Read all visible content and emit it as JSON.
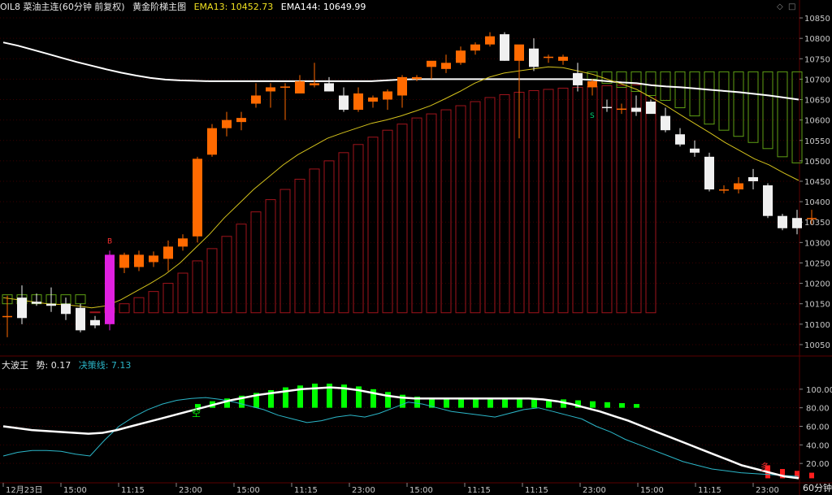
{
  "header": {
    "title": "OIL8 菜油主连(60分钟 前复权)",
    "template": "黄金阶梯主图",
    "ema13_label": "EMA13: 10452.73",
    "ema144_label": "EMA144: 10649.99",
    "diamond_icon": "diamond-icon",
    "square_icon": "square-icon"
  },
  "sub_header": {
    "indicator": "大波王",
    "trend_label": "势: 0.17",
    "decision_label": "决策线: 7.13"
  },
  "period_label": "60分钟",
  "colors": {
    "background": "#000000",
    "bull": "#ff6a00",
    "bear": "#f0f0f0",
    "ema13": "#d4c21c",
    "ema144": "#ffffff",
    "ladder_red": "#a0141c",
    "ladder_green": "#5fa014",
    "osc_white": "#ffffff",
    "osc_cyan": "#2bb6c8",
    "osc_green": "#00ff00",
    "osc_red": "#ff1e1e",
    "axis_text": "#c8c8c8",
    "grid": "#3a0000"
  },
  "chart_data": [
    {
      "type": "candlestick",
      "title": "OIL8 菜油主连(60分钟 前复权)",
      "y_ticks": [
        10850,
        10800,
        10750,
        10700,
        10650,
        10600,
        10550,
        10500,
        10450,
        10400,
        10350,
        10300,
        10250,
        10200,
        10150,
        10100,
        10050
      ],
      "ylim": [
        10026,
        10866
      ],
      "candles": [
        {
          "o": 10120,
          "h": 10170,
          "l": 10068,
          "c": 10120
        },
        {
          "o": 10165,
          "h": 10195,
          "l": 10100,
          "c": 10115
        },
        {
          "o": 10155,
          "h": 10175,
          "l": 10145,
          "c": 10150
        },
        {
          "o": 10150,
          "h": 10190,
          "l": 10130,
          "c": 10145
        },
        {
          "o": 10150,
          "h": 10165,
          "l": 10110,
          "c": 10125
        },
        {
          "o": 10140,
          "h": 10150,
          "l": 10080,
          "c": 10085
        },
        {
          "o": 10110,
          "h": 10120,
          "l": 10090,
          "c": 10097
        },
        {
          "o": 10100,
          "h": 10280,
          "l": 10085,
          "c": 10270
        },
        {
          "o": 10238,
          "h": 10275,
          "l": 10225,
          "c": 10270
        },
        {
          "o": 10240,
          "h": 10280,
          "l": 10230,
          "c": 10270
        },
        {
          "o": 10252,
          "h": 10278,
          "l": 10240,
          "c": 10268
        },
        {
          "o": 10260,
          "h": 10305,
          "l": 10230,
          "c": 10290
        },
        {
          "o": 10290,
          "h": 10320,
          "l": 10280,
          "c": 10310
        },
        {
          "o": 10315,
          "h": 10510,
          "l": 10300,
          "c": 10505
        },
        {
          "o": 10515,
          "h": 10590,
          "l": 10510,
          "c": 10580
        },
        {
          "o": 10580,
          "h": 10620,
          "l": 10560,
          "c": 10600
        },
        {
          "o": 10595,
          "h": 10620,
          "l": 10575,
          "c": 10605
        },
        {
          "o": 10640,
          "h": 10690,
          "l": 10630,
          "c": 10660
        },
        {
          "o": 10670,
          "h": 10690,
          "l": 10630,
          "c": 10680
        },
        {
          "o": 10680,
          "h": 10690,
          "l": 10600,
          "c": 10682
        },
        {
          "o": 10665,
          "h": 10710,
          "l": 10665,
          "c": 10695
        },
        {
          "o": 10685,
          "h": 10740,
          "l": 10680,
          "c": 10690
        },
        {
          "o": 10690,
          "h": 10705,
          "l": 10670,
          "c": 10670
        },
        {
          "o": 10660,
          "h": 10680,
          "l": 10620,
          "c": 10625
        },
        {
          "o": 10625,
          "h": 10680,
          "l": 10620,
          "c": 10665
        },
        {
          "o": 10645,
          "h": 10660,
          "l": 10630,
          "c": 10655
        },
        {
          "o": 10650,
          "h": 10675,
          "l": 10625,
          "c": 10670
        },
        {
          "o": 10660,
          "h": 10710,
          "l": 10630,
          "c": 10705
        },
        {
          "o": 10700,
          "h": 10710,
          "l": 10695,
          "c": 10705
        },
        {
          "o": 10730,
          "h": 10740,
          "l": 10700,
          "c": 10745
        },
        {
          "o": 10725,
          "h": 10760,
          "l": 10715,
          "c": 10740
        },
        {
          "o": 10740,
          "h": 10780,
          "l": 10735,
          "c": 10770
        },
        {
          "o": 10770,
          "h": 10790,
          "l": 10760,
          "c": 10785
        },
        {
          "o": 10785,
          "h": 10815,
          "l": 10780,
          "c": 10805
        },
        {
          "o": 10810,
          "h": 10815,
          "l": 10745,
          "c": 10745
        },
        {
          "o": 10745,
          "h": 10780,
          "l": 10555,
          "c": 10785
        },
        {
          "o": 10775,
          "h": 10800,
          "l": 10720,
          "c": 10730
        },
        {
          "o": 10752,
          "h": 10760,
          "l": 10740,
          "c": 10755
        },
        {
          "o": 10745,
          "h": 10760,
          "l": 10735,
          "c": 10755
        },
        {
          "o": 10715,
          "h": 10740,
          "l": 10670,
          "c": 10685
        },
        {
          "o": 10680,
          "h": 10700,
          "l": 10660,
          "c": 10695
        }
      ],
      "candles_after_signal": [
        {
          "o": 10632,
          "h": 10650,
          "l": 10620,
          "c": 10630
        },
        {
          "o": 10628,
          "h": 10640,
          "l": 10615,
          "c": 10628
        },
        {
          "o": 10630,
          "h": 10660,
          "l": 10610,
          "c": 10620
        },
        {
          "o": 10645,
          "h": 10650,
          "l": 10620,
          "c": 10615
        },
        {
          "o": 10610,
          "h": 10630,
          "l": 10570,
          "c": 10575
        },
        {
          "o": 10565,
          "h": 10580,
          "l": 10535,
          "c": 10540
        },
        {
          "o": 10530,
          "h": 10550,
          "l": 10510,
          "c": 10520
        },
        {
          "o": 10510,
          "h": 10520,
          "l": 10425,
          "c": 10430
        },
        {
          "o": 10430,
          "h": 10440,
          "l": 10420,
          "c": 10430
        },
        {
          "o": 10430,
          "h": 10460,
          "l": 10420,
          "c": 10445
        },
        {
          "o": 10460,
          "h": 10480,
          "l": 10430,
          "c": 10450
        },
        {
          "o": 10440,
          "h": 10445,
          "l": 10360,
          "c": 10365
        },
        {
          "o": 10365,
          "h": 10370,
          "l": 10330,
          "c": 10335
        },
        {
          "o": 10360,
          "h": 10380,
          "l": 10320,
          "c": 10335
        },
        {
          "o": 10360,
          "h": 10380,
          "l": 10345,
          "c": 10360
        }
      ],
      "ema13": [
        10165,
        10160,
        10155,
        10150,
        10148,
        10145,
        10140,
        10145,
        10160,
        10180,
        10200,
        10222,
        10250,
        10285,
        10320,
        10360,
        10395,
        10430,
        10460,
        10490,
        10515,
        10535,
        10555,
        10568,
        10580,
        10592,
        10600,
        10610,
        10622,
        10635,
        10652,
        10670,
        10690,
        10705,
        10715,
        10720,
        10725,
        10730,
        10728,
        10720,
        10712,
        10700,
        10688,
        10675,
        10655,
        10635,
        10612,
        10590,
        10568,
        10545,
        10525,
        10505,
        10490,
        10470,
        10452
      ],
      "ema144": [
        10790,
        10782,
        10772,
        10762,
        10752,
        10742,
        10733,
        10724,
        10716,
        10709,
        10703,
        10699,
        10697,
        10696,
        10695,
        10695,
        10695,
        10695,
        10695,
        10695,
        10695,
        10695,
        10695,
        10695,
        10695,
        10695,
        10697,
        10699,
        10700,
        10700,
        10700,
        10700,
        10700,
        10700,
        10700,
        10700,
        10700,
        10700,
        10700,
        10700,
        10698,
        10695,
        10692,
        10690,
        10685,
        10682,
        10680,
        10677,
        10674,
        10671,
        10668,
        10664,
        10660,
        10655,
        10650
      ],
      "ladder_red": [
        10130,
        10140,
        10150,
        10165,
        10180,
        10200,
        10225,
        10255,
        10285,
        10315,
        10345,
        10375,
        10405,
        10430,
        10455,
        10480,
        10500,
        10520,
        10540,
        10558,
        10575,
        10590,
        10605,
        10615,
        10625,
        10635,
        10645,
        10655,
        10662,
        10668,
        10672,
        10675,
        10678,
        10680,
        10682,
        10684,
        10685,
        10686,
        10686
      ],
      "ladder_green_left": [
        10172,
        10172,
        10172,
        10172,
        10172,
        10172
      ],
      "ladder_green_right": [
        10718,
        10718,
        10718,
        10718,
        10718,
        10718,
        10718,
        10718,
        10718,
        10718,
        10718,
        10718,
        10718,
        10718,
        10718
      ],
      "ladder_green_right_low": [
        10700,
        10690,
        10680,
        10670,
        10660,
        10648,
        10630,
        10610,
        10590,
        10575,
        10560,
        10545,
        10530,
        10510,
        10495
      ],
      "signals": [
        {
          "label": "B",
          "x_index": 7,
          "price": 10298,
          "color": "#ff3030"
        },
        {
          "label": "S",
          "x_index": 40,
          "price": 10605,
          "color": "#00d070"
        }
      ],
      "x_ticks": [
        "12月23日",
        "15:00",
        "11:15",
        "23:00",
        "15:00",
        "11:15",
        "23:00",
        "15:00",
        "11:15",
        "11:15",
        "23:00",
        "15:00",
        "11:15",
        "23:00"
      ]
    },
    {
      "type": "oscillator",
      "title": "大波王",
      "y_ticks": [
        100,
        80,
        60,
        40,
        20
      ],
      "ylim": [
        0,
        120
      ],
      "white_line": [
        60,
        58,
        56,
        55,
        54,
        53,
        52,
        53,
        56,
        60,
        64,
        68,
        72,
        76,
        80,
        84,
        88,
        91,
        94,
        96,
        98,
        100,
        101,
        102,
        101,
        99,
        96,
        93,
        91,
        90,
        90,
        90,
        90,
        90,
        90,
        90,
        90,
        90,
        89,
        87,
        84,
        80,
        76,
        71,
        66,
        60,
        54,
        48,
        42,
        36,
        30,
        24,
        18,
        14,
        10,
        6,
        4
      ],
      "cyan_line": [
        28,
        32,
        34,
        34,
        33,
        30,
        28,
        45,
        60,
        70,
        78,
        84,
        88,
        90,
        91,
        89,
        86,
        82,
        78,
        72,
        68,
        64,
        66,
        70,
        72,
        70,
        74,
        80,
        86,
        84,
        80,
        76,
        74,
        72,
        70,
        74,
        78,
        80,
        76,
        72,
        68,
        60,
        54,
        46,
        40,
        34,
        28,
        22,
        18,
        14,
        12,
        10,
        9,
        8,
        7,
        6
      ],
      "bars_green": [
        84,
        87,
        90,
        93,
        96,
        99,
        102,
        104,
        106,
        106,
        105,
        103,
        100,
        97,
        94,
        92,
        91,
        90,
        89,
        89,
        89,
        89,
        89,
        89,
        89,
        89,
        88,
        87,
        86,
        85,
        84
      ],
      "bars_red": [
        18,
        14,
        12,
        10
      ],
      "labels": [
        {
          "text": "空",
          "color": "#00ff00"
        },
        {
          "text": "多",
          "color": "#ff3030"
        }
      ]
    }
  ]
}
